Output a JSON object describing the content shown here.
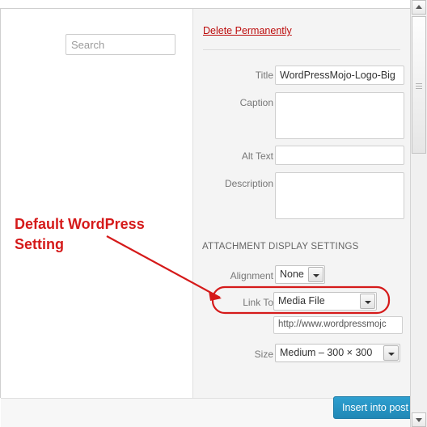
{
  "window": {
    "left_pane": {
      "search": {
        "placeholder": "Search",
        "value": ""
      }
    },
    "right_pane": {
      "delete_link": "Delete Permanently",
      "fields": [
        {
          "label": "Title",
          "value": "WordPressMojo-Logo-Big",
          "type": "text"
        },
        {
          "label": "Caption",
          "value": "",
          "type": "textarea"
        },
        {
          "label": "Alt Text",
          "value": "",
          "type": "text"
        },
        {
          "label": "Description",
          "value": "",
          "type": "textarea"
        }
      ],
      "section_heading": "ATTACHMENT DISPLAY SETTINGS",
      "settings": [
        {
          "label": "Alignment",
          "value": "None"
        },
        {
          "label": "Link To",
          "value": "Media File"
        },
        {
          "label": "Size",
          "value": "Medium – 300 × 300"
        }
      ],
      "link_url": "http://www.wordpressmojc"
    },
    "footer": {
      "insert_button": "Insert into post"
    }
  },
  "annotation": {
    "text": "Default WordPress Setting",
    "color": "#d51a1a"
  },
  "icons": {
    "scroll_up": "scroll-up-arrow-icon",
    "scroll_down": "scroll-down-arrow-icon",
    "dropdown_arrow": "chevron-down-icon"
  }
}
